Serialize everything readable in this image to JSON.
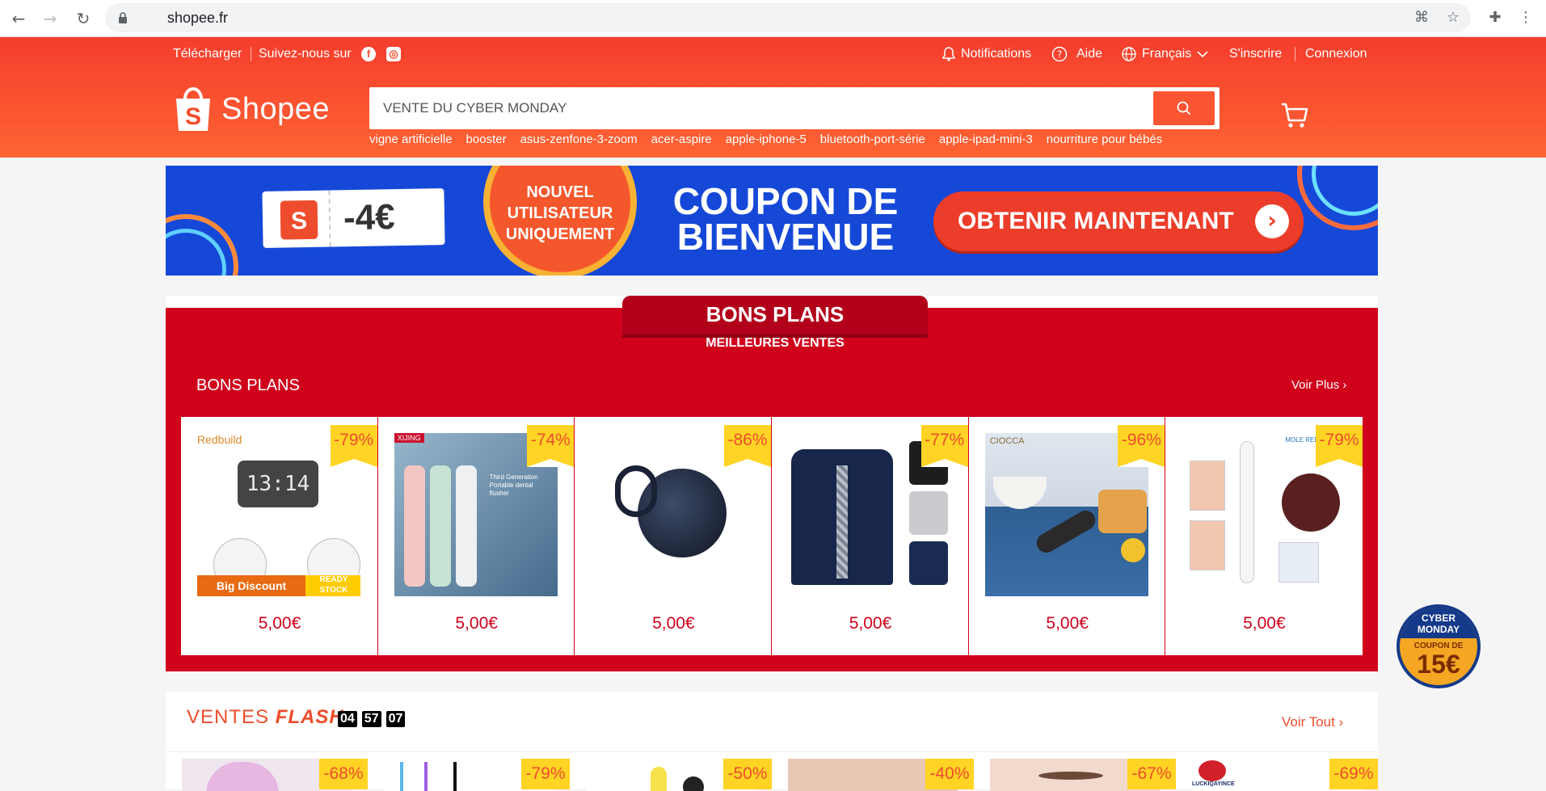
{
  "browser": {
    "url": "shopee.fr"
  },
  "topbar": {
    "download": "Télécharger",
    "follow": "Suivez-nous sur",
    "notifications": "Notifications",
    "help": "Aide",
    "language": "Français",
    "signup": "S'inscrire",
    "login": "Connexion"
  },
  "header": {
    "logo_text": "Shopee",
    "search_placeholder": "VENTE DU CYBER MONDAY",
    "suggestions": [
      "vigne artificielle",
      "booster",
      "asus-zenfone-3-zoom",
      "acer-aspire",
      "apple-iphone-5",
      "bluetooth-port-série",
      "apple-ipad-mini-3",
      "nourriture pour bébés"
    ]
  },
  "banner": {
    "ticket_amount": "-4€",
    "new_user": [
      "NOUVEL",
      "UTILISATEUR",
      "UNIQUEMENT"
    ],
    "coupon_title_1": "COUPON DE",
    "coupon_title_2": "BIENVENUE",
    "cta": "OBTENIR MAINTENANT"
  },
  "bons_plans": {
    "ribbon_title": "BONS PLANS",
    "ribbon_sub": "MEILLEURES VENTES",
    "label": "BONS PLANS",
    "see_more": "Voir Plus",
    "products": [
      {
        "discount": "-79%",
        "price": "5,00€",
        "brand": "Redbuild",
        "tag": "Big Discount",
        "tag2": "READY STOCK",
        "icon": "alarm-clock"
      },
      {
        "discount": "-74%",
        "price": "5,00€",
        "brand": "XIJING",
        "caption": "Third Generation Portable dental flusher",
        "icon": "water-flosser"
      },
      {
        "discount": "-86%",
        "price": "5,00€",
        "icon": "earbuds"
      },
      {
        "discount": "-77%",
        "price": "5,00€",
        "icon": "jacket"
      },
      {
        "discount": "-96%",
        "price": "5,00€",
        "brand": "CIOCCA",
        "icon": "hand-mixer"
      },
      {
        "discount": "-79%",
        "price": "5,00€",
        "brand": "MOLE REM",
        "icon": "beauty-pen"
      }
    ]
  },
  "flash": {
    "title_a": "VENTES",
    "title_b": "FLASH",
    "timer": [
      "04",
      "57",
      "07"
    ],
    "see_all": "Voir Tout",
    "items": [
      {
        "discount": "-68%"
      },
      {
        "discount": "-79%"
      },
      {
        "discount": "-50%"
      },
      {
        "discount": "-40%"
      },
      {
        "discount": "-67%"
      },
      {
        "discount": "-69%",
        "brand": "LUCKIQAYINCE"
      }
    ]
  },
  "float_coupon": {
    "line1": "CYBER",
    "line2": "MONDAY",
    "line3": "COUPON DE",
    "amount": "15€"
  },
  "colors": {
    "brand": "#ee4d2d",
    "deal_red": "#d0011b",
    "badge_yellow": "#ffd424",
    "banner_blue": "#1648d8"
  }
}
